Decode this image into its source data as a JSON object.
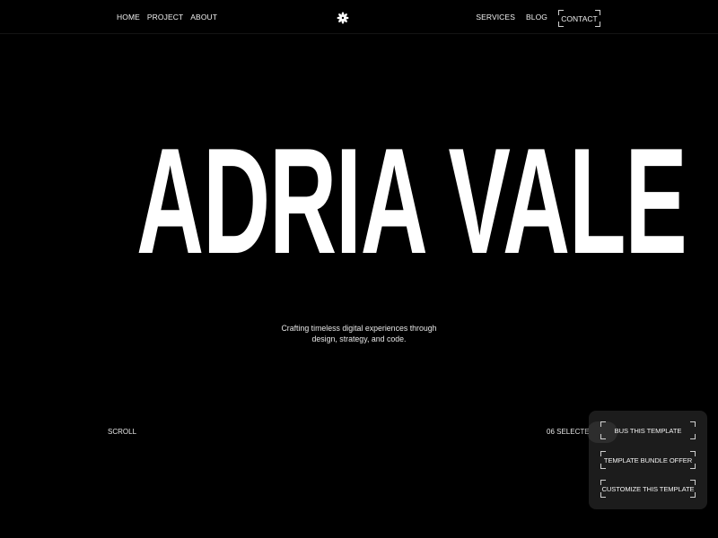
{
  "nav": {
    "left_links": [
      "HOME",
      "PROJECT",
      "ABOUT"
    ],
    "right_links": [
      "SERVICES",
      "BLOG"
    ],
    "contact_label": "CONTACT",
    "logo_icon": "asterisk-flower-icon"
  },
  "hero": {
    "title": "ADRIA VALE",
    "tagline_line1": "Crafting timeless digital experiences through",
    "tagline_line2": "design, strategy, and code."
  },
  "footer": {
    "scroll_label": "SCROLL",
    "selected_label": "06 SELECTED W"
  },
  "panel": {
    "buttons": [
      "BUS THIS TEMPLATE",
      "TEMPLATE BUNDLE OFFER",
      "CUSTOMIZE THIS TEMPLATE"
    ]
  },
  "colors": {
    "background": "#000000",
    "text": "#ffffff",
    "panel_bg": "#1c1c1c"
  }
}
